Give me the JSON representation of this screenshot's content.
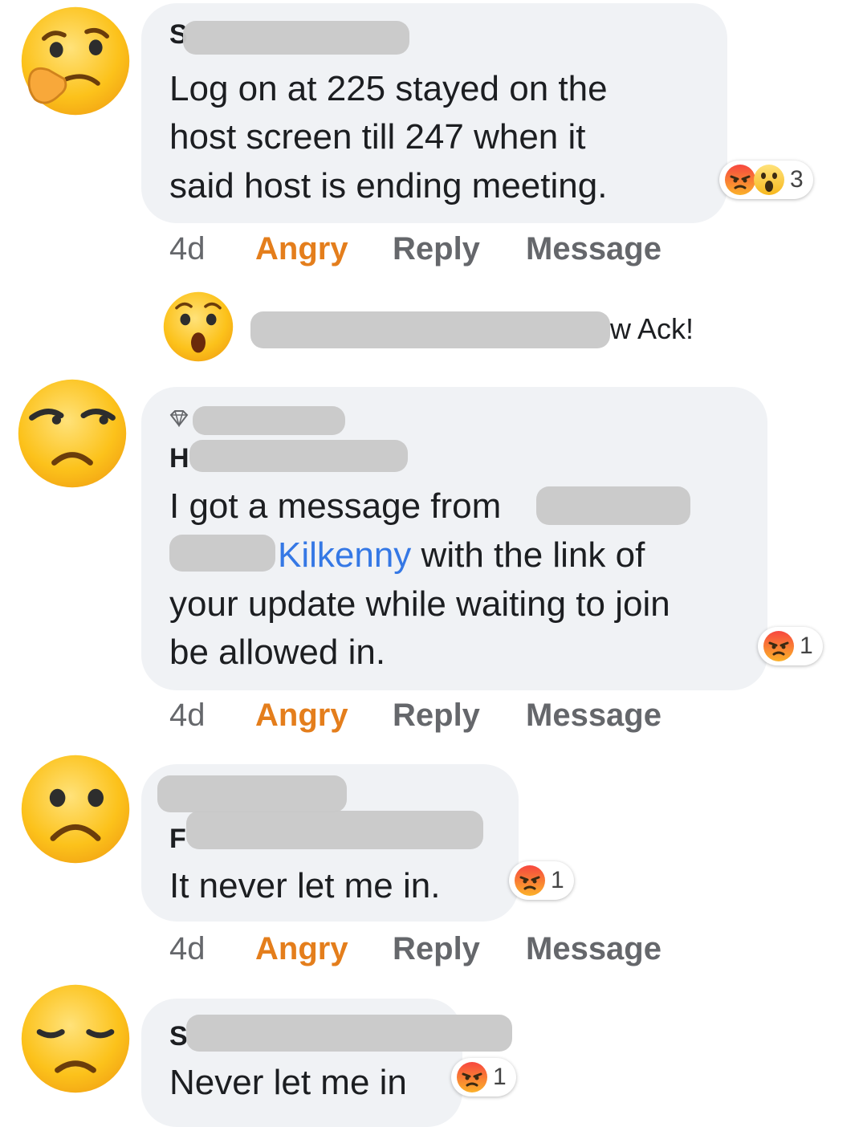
{
  "comments": [
    {
      "author_visible": "S",
      "text_lines": [
        "Log on at 225 stayed on the",
        "host screen till 247 when it",
        "said host is ending meeting."
      ],
      "reaction_count": "3",
      "reaction_icons": [
        "angry-icon",
        "wow-icon"
      ],
      "time": "4d",
      "reaction_label": "Angry",
      "reply_label": "Reply",
      "message_label": "Message",
      "avatar": "thinking-face-icon"
    },
    {
      "type": "reply-preview",
      "text_visible": "w Ack!",
      "avatar": "surprised-face-icon"
    },
    {
      "author_visible": "H",
      "text_line1": "I got a message from",
      "link_text": "Kilkenny",
      "text_line2_rest": "with the link of",
      "text_lines_rest": [
        "your update while waiting to join",
        "be allowed in."
      ],
      "reaction_count": "1",
      "reaction_icons": [
        "angry-icon"
      ],
      "time": "4d",
      "reaction_label": "Angry",
      "reply_label": "Reply",
      "message_label": "Message",
      "avatar": "unamused-face-icon"
    },
    {
      "author_visible": "F",
      "text": "It never let me in.",
      "reaction_count": "1",
      "reaction_icons": [
        "angry-icon"
      ],
      "time": "4d",
      "reaction_label": "Angry",
      "reply_label": "Reply",
      "message_label": "Message",
      "avatar": "frowning-face-icon"
    },
    {
      "author_visible": "S",
      "text": "Never let me in",
      "reaction_count": "1",
      "reaction_icons": [
        "angry-icon"
      ],
      "avatar": "pensive-face-icon"
    }
  ],
  "colors": {
    "bubble": "#f0f2f5",
    "angry_label": "#e47e1c",
    "meta": "#65676b",
    "link": "#3578e5",
    "redaction": "#c9c9c9"
  }
}
